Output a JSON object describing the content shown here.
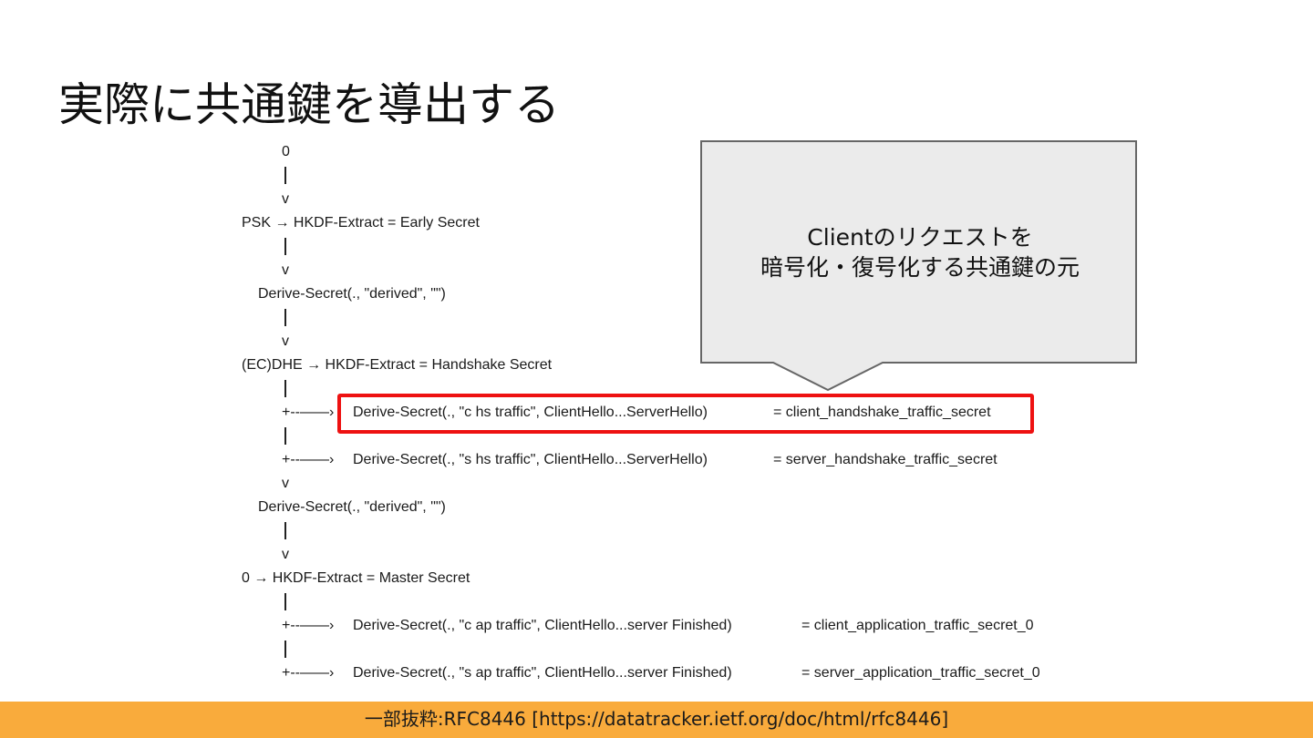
{
  "slide": {
    "title": "実際に共通鍵を導出する"
  },
  "schedule": {
    "zero_top": "0",
    "v": "v",
    "psk_line": "PSK →  HKDF-Extract = Early Secret",
    "derive_derived": "Derive-Secret(., \"derived\", \"\")",
    "ecdhe_line": "(EC)DHE → HKDF-Extract = Handshake Secret",
    "branch_prefix": "+--——›",
    "c_hs": "Derive-Secret(., \"c hs traffic\", ClientHello...ServerHello)",
    "c_hs_result": "= client_handshake_traffic_secret",
    "s_hs": "Derive-Secret(., \"s hs traffic\", ClientHello...ServerHello)",
    "s_hs_result": "= server_handshake_traffic_secret",
    "zero_line": "0 → HKDF-Extract = Master Secret",
    "c_ap": "Derive-Secret(., \"c ap traffic\", ClientHello...server Finished)",
    "c_ap_result": "= client_application_traffic_secret_0",
    "s_ap": "Derive-Secret(., \"s ap traffic\", ClientHello...server Finished)",
    "s_ap_result": "= server_application_traffic_secret_0"
  },
  "callout": {
    "line1": "Clientのリクエストを",
    "line2": "暗号化・復号化する共通鍵の元"
  },
  "footer": {
    "text": "一部抜粋:RFC8446 [https://datatracker.ietf.org/doc/html/rfc8446]"
  },
  "colors": {
    "highlight": "#ee1111",
    "footer_bg": "#f9ab3c",
    "callout_fill": "#ebebeb",
    "callout_stroke": "#666666"
  }
}
